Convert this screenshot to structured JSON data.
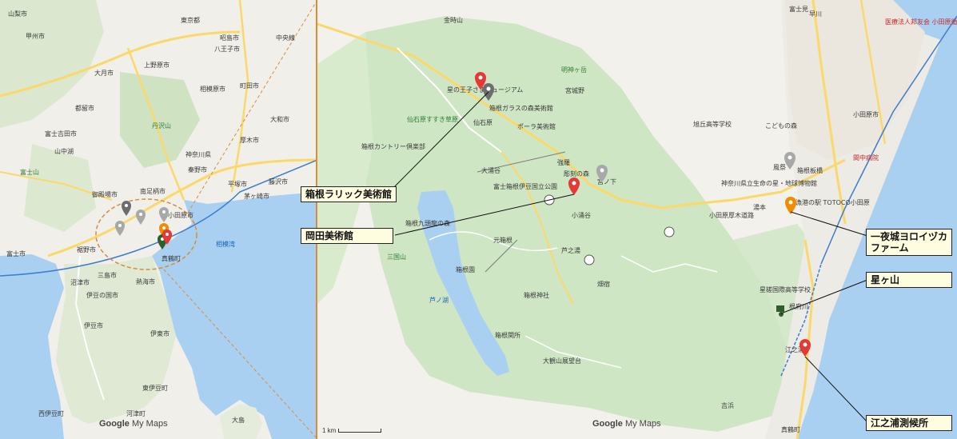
{
  "left_map": {
    "labels": [
      {
        "text": "東京都",
        "color": "dark"
      },
      {
        "text": "八王子市",
        "color": "dark"
      },
      {
        "text": "昭島市",
        "color": "dark"
      },
      {
        "text": "町田市",
        "color": "dark"
      },
      {
        "text": "相模原市",
        "color": "dark"
      },
      {
        "text": "上野原市",
        "color": "dark"
      },
      {
        "text": "甲州市",
        "color": "dark"
      },
      {
        "text": "大月市",
        "color": "dark"
      },
      {
        "text": "都留市",
        "color": "dark"
      },
      {
        "text": "富士吉田市",
        "color": "dark"
      },
      {
        "text": "丹沢山",
        "color": "green"
      },
      {
        "text": "神奈川県",
        "color": "dark"
      },
      {
        "text": "厚木市",
        "color": "dark"
      },
      {
        "text": "秦野市",
        "color": "dark"
      },
      {
        "text": "平塚市",
        "color": "dark"
      },
      {
        "text": "藤沢市",
        "color": "dark"
      },
      {
        "text": "茅ヶ崎市",
        "color": "dark"
      },
      {
        "text": "大和市",
        "color": "dark"
      },
      {
        "text": "小田原市",
        "color": "dark"
      },
      {
        "text": "南足柄市",
        "color": "dark"
      },
      {
        "text": "御殿場市",
        "color": "dark"
      },
      {
        "text": "富士山",
        "color": "green"
      },
      {
        "text": "富士市",
        "color": "dark"
      },
      {
        "text": "裾野市",
        "color": "dark"
      },
      {
        "text": "沼津市",
        "color": "dark"
      },
      {
        "text": "三島市",
        "color": "dark"
      },
      {
        "text": "熱海市",
        "color": "dark"
      },
      {
        "text": "真鶴町",
        "color": "dark"
      },
      {
        "text": "伊豆の国市",
        "color": "dark"
      },
      {
        "text": "伊豆市",
        "color": "dark"
      },
      {
        "text": "伊東市",
        "color": "dark"
      },
      {
        "text": "西伊豆町",
        "color": "dark"
      },
      {
        "text": "東伊豆町",
        "color": "dark"
      },
      {
        "text": "河津町",
        "color": "dark"
      },
      {
        "text": "大島",
        "color": "dark"
      },
      {
        "text": "相模湾",
        "color": "water"
      },
      {
        "text": "山梨市",
        "color": "dark"
      },
      {
        "text": "山中湖",
        "color": "dark"
      },
      {
        "text": "中央線",
        "color": "dark"
      }
    ],
    "google_brand": "Google",
    "my_maps": "My Maps"
  },
  "right_map": {
    "labels": [
      {
        "text": "金時山",
        "color": "dark"
      },
      {
        "text": "明神ヶ岳",
        "color": "green"
      },
      {
        "text": "宮城野",
        "color": "dark"
      },
      {
        "text": "星の王子さまミュージアム",
        "color": "dark"
      },
      {
        "text": "箱根ガラスの森美術館",
        "color": "dark"
      },
      {
        "text": "仙石原すすき草原",
        "color": "green"
      },
      {
        "text": "仙石原",
        "color": "dark"
      },
      {
        "text": "ポーラ美術館",
        "color": "dark"
      },
      {
        "text": "箱根カントリー倶楽部",
        "color": "dark"
      },
      {
        "text": "大涌谷",
        "color": "dark"
      },
      {
        "text": "強羅",
        "color": "dark"
      },
      {
        "text": "彫刻の森",
        "color": "dark"
      },
      {
        "text": "宮ノ下",
        "color": "dark"
      },
      {
        "text": "富士箱根伊豆国立公園",
        "color": "dark"
      },
      {
        "text": "箱根九頭龍の森",
        "color": "dark"
      },
      {
        "text": "元箱根",
        "color": "dark"
      },
      {
        "text": "箱根園",
        "color": "dark"
      },
      {
        "text": "芦ノ湖",
        "color": "water"
      },
      {
        "text": "箱根神社",
        "color": "dark"
      },
      {
        "text": "箱根関所",
        "color": "dark"
      },
      {
        "text": "大観山展望台",
        "color": "dark"
      },
      {
        "text": "三国山",
        "color": "green"
      },
      {
        "text": "小涌谷",
        "color": "dark"
      },
      {
        "text": "芦之湯",
        "color": "dark"
      },
      {
        "text": "畑宿",
        "color": "dark"
      },
      {
        "text": "湯本",
        "color": "dark"
      },
      {
        "text": "小田原市",
        "color": "dark"
      },
      {
        "text": "風祭",
        "color": "dark"
      },
      {
        "text": "箱根板橋",
        "color": "dark"
      },
      {
        "text": "神奈川県立生命の星・地球博物館",
        "color": "dark"
      },
      {
        "text": "漁港の駅 TOTOCO小田原",
        "color": "dark"
      },
      {
        "text": "旭丘高等学校",
        "color": "dark"
      },
      {
        "text": "こどもの森",
        "color": "dark"
      },
      {
        "text": "星槎国際高等学校",
        "color": "dark"
      },
      {
        "text": "根府川",
        "color": "dark"
      },
      {
        "text": "江之浦",
        "color": "dark"
      },
      {
        "text": "真鶴町",
        "color": "dark"
      },
      {
        "text": "早川",
        "color": "dark"
      },
      {
        "text": "小田原厚木道路",
        "color": "dark"
      },
      {
        "text": "医療法人邦友会 小田原循環器病院",
        "color": "red"
      },
      {
        "text": "間中病院",
        "color": "red"
      },
      {
        "text": "富士見",
        "color": "dark"
      },
      {
        "text": "吉浜",
        "color": "dark"
      }
    ],
    "scale_text": "1 km",
    "google_brand": "Google",
    "my_maps": "My Maps"
  },
  "callouts": [
    {
      "id": "lalique",
      "text": "箱根ラリック美術館"
    },
    {
      "id": "okada",
      "text": "岡田美術館"
    },
    {
      "id": "ichiya",
      "text": "一夜城ヨロイヅカ\nファーム"
    },
    {
      "id": "hoshigayama",
      "text": "星ヶ山"
    },
    {
      "id": "enoura",
      "text": "江之浦測候所"
    }
  ],
  "colors": {
    "land": "#f3f1ec",
    "green_area": "#cfe6c4",
    "park": "#bfdfb0",
    "water": "#a9d0f0",
    "road_major": "#fbd86a",
    "road_minor": "#ffffff",
    "pin_red": "#e53935",
    "pin_gray": "#8a8a8a",
    "pin_orange": "#f08c00",
    "pin_green": "#2e5e2b",
    "frame": "#d98c3a"
  }
}
